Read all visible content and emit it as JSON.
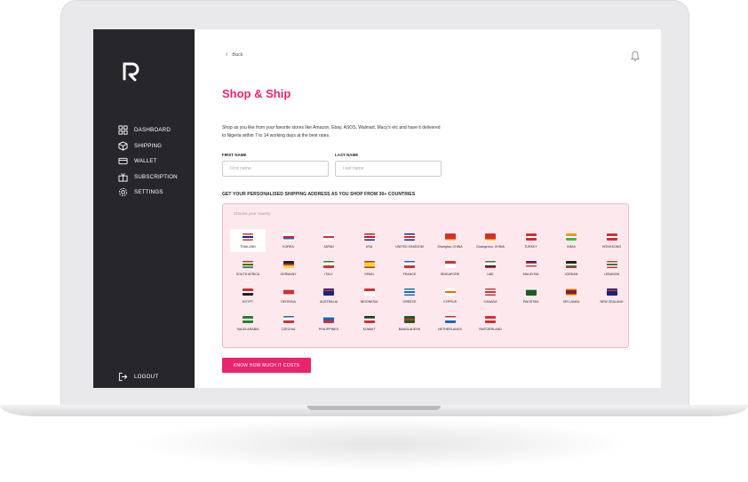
{
  "sidebar": {
    "items": [
      {
        "label": "DASHBOARD",
        "icon": "grid-icon"
      },
      {
        "label": "SHIPPING",
        "icon": "box-icon"
      },
      {
        "label": "WALLET",
        "icon": "wallet-icon"
      },
      {
        "label": "SUBSCRIPTION",
        "icon": "gift-icon"
      },
      {
        "label": "SETTINGS",
        "icon": "gear-icon"
      }
    ],
    "logout_label": "LOGOUT"
  },
  "header": {
    "back_label": "Back"
  },
  "page": {
    "title": "Shop & Ship",
    "description": "Shop as you like from your favorite stores like Amazon, Ebay, ASOS, Walmart, Macy's etc and have it delivered to Nigeria within 7 to 14 working days at the best rates.",
    "first_name_label": "FIRST NAME",
    "first_name_placeholder": "First name",
    "last_name_label": "LAST NAME",
    "last_name_placeholder": "Last name",
    "section_heading": "GET YOUR PERSONALISED SHIPPING ADDRESS AS YOU SHOP FROM 30+ COUNTRIES",
    "choose_label": "Choose your country",
    "cta_label": "KNOW HOW MUCH IT COSTS"
  },
  "countries": [
    {
      "name": "THAILAND",
      "colors": [
        "#d32f2f",
        "#ffffff",
        "#1a237e",
        "#ffffff",
        "#d32f2f"
      ],
      "selected": true
    },
    {
      "name": "KOREA",
      "colors": [
        "#ffffff",
        "#ffffff",
        "#c62828",
        "#1565c0",
        "#ffffff"
      ]
    },
    {
      "name": "JAPAN",
      "colors": [
        "#ffffff",
        "#ffffff",
        "#d32f2f",
        "#ffffff",
        "#ffffff"
      ]
    },
    {
      "name": "USA",
      "colors": [
        "#b71c1c",
        "#ffffff",
        "#b71c1c",
        "#ffffff",
        "#1a237e"
      ]
    },
    {
      "name": "UNITED KINGDOM",
      "colors": [
        "#1a237e",
        "#ffffff",
        "#c62828",
        "#ffffff",
        "#1a237e"
      ]
    },
    {
      "name": "Shanghai, CHINA",
      "colors": [
        "#d32f2f",
        "#d32f2f",
        "#d32f2f",
        "#d32f2f",
        "#fdd835"
      ]
    },
    {
      "name": "Guangzhou, CHINA",
      "colors": [
        "#d32f2f",
        "#d32f2f",
        "#d32f2f",
        "#d32f2f",
        "#fdd835"
      ]
    },
    {
      "name": "TURKEY",
      "colors": [
        "#d32f2f",
        "#d32f2f",
        "#ffffff",
        "#d32f2f",
        "#d32f2f"
      ]
    },
    {
      "name": "INDIA",
      "colors": [
        "#ff9800",
        "#ff9800",
        "#ffffff",
        "#4caf50",
        "#4caf50"
      ]
    },
    {
      "name": "HONGKONG",
      "colors": [
        "#d32f2f",
        "#d32f2f",
        "#ffffff",
        "#d32f2f",
        "#d32f2f"
      ]
    },
    {
      "name": "SOUTH AFRICA",
      "colors": [
        "#d32f2f",
        "#ffffff",
        "#2e7d32",
        "#fdd835",
        "#1565c0"
      ]
    },
    {
      "name": "GERMANY",
      "colors": [
        "#212121",
        "#212121",
        "#d32f2f",
        "#fdd835",
        "#fdd835"
      ]
    },
    {
      "name": "ITALY",
      "colors": [
        "#2e7d32",
        "#ffffff",
        "#ffffff",
        "#d32f2f",
        "#d32f2f"
      ]
    },
    {
      "name": "SPAIN",
      "colors": [
        "#c62828",
        "#fdd835",
        "#fdd835",
        "#fdd835",
        "#c62828"
      ]
    },
    {
      "name": "FRANCE",
      "colors": [
        "#1565c0",
        "#ffffff",
        "#ffffff",
        "#d32f2f",
        "#d32f2f"
      ]
    },
    {
      "name": "SINGAPORE",
      "colors": [
        "#d32f2f",
        "#d32f2f",
        "#ffffff",
        "#ffffff",
        "#ffffff"
      ]
    },
    {
      "name": "UAE",
      "colors": [
        "#2e7d32",
        "#ffffff",
        "#ffffff",
        "#212121",
        "#d32f2f"
      ]
    },
    {
      "name": "MALAYSIA",
      "colors": [
        "#1a237e",
        "#d32f2f",
        "#ffffff",
        "#d32f2f",
        "#ffffff"
      ]
    },
    {
      "name": "JORDAN",
      "colors": [
        "#212121",
        "#212121",
        "#ffffff",
        "#2e7d32",
        "#c62828"
      ]
    },
    {
      "name": "LEBANON",
      "colors": [
        "#d32f2f",
        "#ffffff",
        "#2e7d32",
        "#ffffff",
        "#d32f2f"
      ]
    },
    {
      "name": "EGYPT",
      "colors": [
        "#d32f2f",
        "#d32f2f",
        "#ffffff",
        "#212121",
        "#212121"
      ]
    },
    {
      "name": "GEORGIA",
      "colors": [
        "#ffffff",
        "#d32f2f",
        "#d32f2f",
        "#d32f2f",
        "#ffffff"
      ]
    },
    {
      "name": "AUSTRALIA",
      "colors": [
        "#1a237e",
        "#d32f2f",
        "#1a237e",
        "#1a237e",
        "#1a237e"
      ]
    },
    {
      "name": "INDONESIA",
      "colors": [
        "#d32f2f",
        "#d32f2f",
        "#ffffff",
        "#ffffff",
        "#ffffff"
      ]
    },
    {
      "name": "GREECE",
      "colors": [
        "#1565c0",
        "#ffffff",
        "#1565c0",
        "#ffffff",
        "#1565c0"
      ]
    },
    {
      "name": "CYPRUS",
      "colors": [
        "#ffffff",
        "#ffffff",
        "#ef6c00",
        "#ffffff",
        "#ffffff"
      ]
    },
    {
      "name": "CANADA",
      "colors": [
        "#d32f2f",
        "#ffffff",
        "#d32f2f",
        "#ffffff",
        "#d32f2f"
      ]
    },
    {
      "name": "PAKISTAN",
      "colors": [
        "#ffffff",
        "#1b5e20",
        "#1b5e20",
        "#1b5e20",
        "#1b5e20"
      ]
    },
    {
      "name": "SRI LANKA",
      "colors": [
        "#fbc02d",
        "#8d1b2e",
        "#8d1b2e",
        "#8d1b2e",
        "#fbc02d"
      ]
    },
    {
      "name": "NEW ZEALAND",
      "colors": [
        "#1a237e",
        "#d32f2f",
        "#1a237e",
        "#1a237e",
        "#1a237e"
      ]
    },
    {
      "name": "SAUDI ARABIA",
      "colors": [
        "#2e7d32",
        "#2e7d32",
        "#ffffff",
        "#2e7d32",
        "#2e7d32"
      ]
    },
    {
      "name": "CZECHIA",
      "colors": [
        "#1565c0",
        "#ffffff",
        "#ffffff",
        "#d32f2f",
        "#d32f2f"
      ]
    },
    {
      "name": "PHILIPPINES",
      "colors": [
        "#ffffff",
        "#1565c0",
        "#1565c0",
        "#d32f2f",
        "#d32f2f"
      ]
    },
    {
      "name": "KUWAIT",
      "colors": [
        "#212121",
        "#2e7d32",
        "#ffffff",
        "#d32f2f",
        "#d32f2f"
      ]
    },
    {
      "name": "BANGLADESH",
      "colors": [
        "#1b5e20",
        "#1b5e20",
        "#d32f2f",
        "#1b5e20",
        "#1b5e20"
      ]
    },
    {
      "name": "NETHERLANDS",
      "colors": [
        "#c62828",
        "#ffffff",
        "#ffffff",
        "#1565c0",
        "#1565c0"
      ]
    },
    {
      "name": "SWITZERLAND",
      "colors": [
        "#d32f2f",
        "#d32f2f",
        "#ffffff",
        "#d32f2f",
        "#d32f2f"
      ]
    }
  ],
  "colors": {
    "accent": "#e8246c",
    "sidebar_bg": "#27262b",
    "panel_bg": "#fde8ee"
  }
}
